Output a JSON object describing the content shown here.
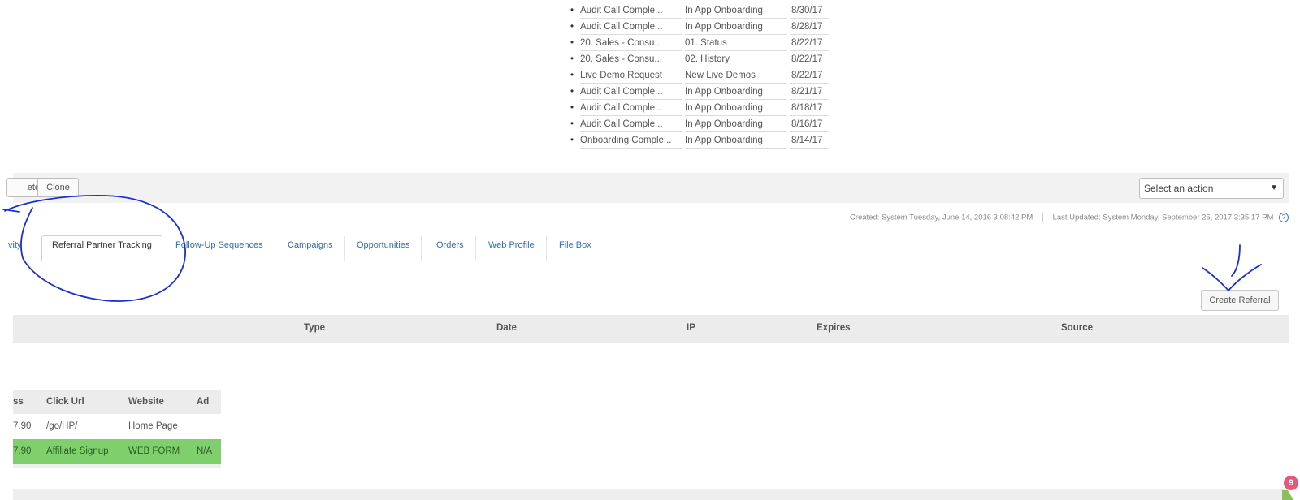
{
  "history": [
    {
      "name": "Audit Call Comple...",
      "category": "In App Onboarding",
      "date": "8/30/17"
    },
    {
      "name": "Audit Call Comple...",
      "category": "In App Onboarding",
      "date": "8/28/17"
    },
    {
      "name": "20. Sales - Consu...",
      "category": "01. Status",
      "date": "8/22/17"
    },
    {
      "name": "20. Sales - Consu...",
      "category": "02. History",
      "date": "8/22/17"
    },
    {
      "name": "Live Demo Request",
      "category": "New Live Demos",
      "date": "8/22/17"
    },
    {
      "name": "Audit Call Comple...",
      "category": "In App Onboarding",
      "date": "8/21/17"
    },
    {
      "name": "Audit Call Comple...",
      "category": "In App Onboarding",
      "date": "8/18/17"
    },
    {
      "name": "Audit Call Comple...",
      "category": "In App Onboarding",
      "date": "8/16/17"
    },
    {
      "name": "Onboarding Comple...",
      "category": "In App Onboarding",
      "date": "8/14/17"
    }
  ],
  "toolbar": {
    "delete_label": "ete",
    "clone_label": "Clone",
    "action_select": "Select an action",
    "action_arrow": "▼"
  },
  "meta": {
    "created": "Created:  System Tuesday, June 14, 2016 3:08:42 PM",
    "updated": "Last Updated:  System Monday, September 25, 2017 3:35:17 PM",
    "help": "?"
  },
  "tabs": {
    "activity": "vity",
    "referral": "Referral Partner Tracking",
    "followup": "Follow-Up Sequences",
    "campaigns": "Campaigns",
    "opportunities": "Opportunities",
    "orders": "Orders",
    "webprofile": "Web Profile",
    "filebox": "File Box"
  },
  "create_referral": "Create Referral",
  "referral_table": {
    "columns": [
      "Type",
      "Date",
      "IP",
      "Expires",
      "Source"
    ]
  },
  "click_table": {
    "columns": [
      "ss",
      "Click Url",
      "Website",
      "Ad"
    ],
    "rows": [
      {
        "ip": "7.90",
        "url": "/go/HP/",
        "website": "Home Page",
        "ad": ""
      },
      {
        "ip": "7.90",
        "url": "Affiliate Signup",
        "website": "WEB FORM",
        "ad": "N/A"
      }
    ]
  },
  "notifications": {
    "count": "9"
  },
  "colors": {
    "link": "#2f6eb2",
    "highlight_row": "#7fd06d",
    "annotation_ink": "#1a2ed6",
    "badge": "#e8577b"
  }
}
